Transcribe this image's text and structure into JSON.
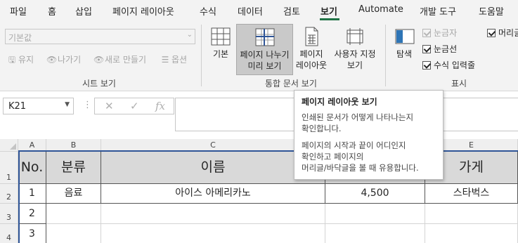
{
  "tabs": [
    "파일",
    "홈",
    "삽입",
    "페이지 레이아웃",
    "수식",
    "데이터",
    "검토",
    "보기",
    "Automate",
    "개발 도구",
    "도움말"
  ],
  "active_tab": "보기",
  "ribbon": {
    "sheet_view": {
      "combo_value": "기본값",
      "keep": "유지",
      "exit": "나가기",
      "new": "새로 만들기",
      "options": "옵션",
      "label": "시트 보기"
    },
    "workbook_views": {
      "normal": "기본",
      "page_break_line1": "페이지 나누기",
      "page_break_line2": "미리 보기",
      "page_layout_line1": "페이지",
      "page_layout_line2": "레이아웃",
      "custom_line1": "사용자 지정",
      "custom_line2": "보기",
      "label": "통합 문서 보기"
    },
    "navigation": "탐색",
    "show": {
      "ruler": "눈금자",
      "gridlines": "눈금선",
      "formula_bar": "수식 입력줄",
      "headings": "머리글",
      "label": "표시"
    }
  },
  "formula_bar": {
    "name_box": "K21",
    "cancel": "✕",
    "enter": "✓",
    "fx": "fx",
    "value": ""
  },
  "grid": {
    "columns": [
      "A",
      "B",
      "C",
      "D",
      "E"
    ],
    "rows": [
      "1",
      "2",
      "3",
      "4"
    ],
    "header_row": [
      "No.",
      "분류",
      "이름",
      "",
      "가게"
    ],
    "row2": [
      "1",
      "음료",
      "아이스 아메리카노",
      "4,500",
      "스타벅스"
    ],
    "row3_a": "2",
    "row4_a": "3"
  },
  "tooltip": {
    "title": "페이지 레이아웃 보기",
    "p1": "인쇄된 문서가 어떻게 나타나는지\n확인합니다.",
    "p2": "페이지의 시작과 끝이 어디인지\n확인하고 페이지의\n머리글/바닥글을 볼 때 유용합니다."
  },
  "colors": {
    "accent": "#217346",
    "page_break": "#2f5597",
    "header_fill": "#d9d9d9"
  }
}
